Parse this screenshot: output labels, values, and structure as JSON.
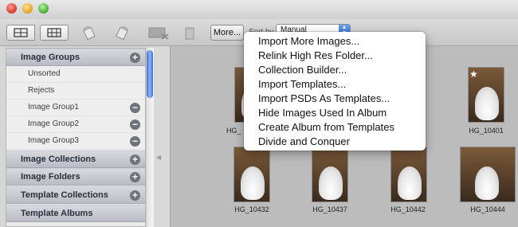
{
  "toolbar": {
    "more_label": "More...",
    "sort_label": "Sort by",
    "sort_value": "Manual",
    "icons": [
      "single-view-icon",
      "grid-view-icon",
      "rotate-left-icon",
      "rotate-right-icon",
      "remove-icon",
      "trash-icon"
    ]
  },
  "sidebar": {
    "headers": [
      {
        "label": "Image Groups",
        "action": "+"
      },
      {
        "label": "Image Collections",
        "action": "+"
      },
      {
        "label": "Image Folders",
        "action": "+"
      },
      {
        "label": "Template Collections",
        "action": "+"
      },
      {
        "label": "Template Albums",
        "action": ""
      }
    ],
    "groups": [
      {
        "label": "Unsorted",
        "action": ""
      },
      {
        "label": "Rejects",
        "action": ""
      },
      {
        "label": "Image Group1",
        "action": "−"
      },
      {
        "label": "Image Group2",
        "action": "−"
      },
      {
        "label": "Image Group3",
        "action": "−"
      }
    ]
  },
  "menu": {
    "items": [
      "Import More Images...",
      "Relink High Res Folder...",
      "Collection Builder...",
      "Import Templates...",
      "Import PSDs As Templates...",
      "Hide Images Used In Album",
      "Create Album from Templates",
      "Divide and Conquer"
    ]
  },
  "thumbnails": {
    "row1": [
      {
        "caption": "HG_",
        "starred": false
      },
      {
        "caption": "",
        "starred": false
      },
      {
        "caption": "0",
        "starred": false
      },
      {
        "caption": "HG_10401",
        "starred": true
      }
    ],
    "row2": [
      {
        "caption": "HG_10432",
        "starred": false
      },
      {
        "caption": "HG_10437",
        "starred": false
      },
      {
        "caption": "HG_10442",
        "starred": false
      },
      {
        "caption": "HG_10444",
        "starred": false
      }
    ]
  }
}
